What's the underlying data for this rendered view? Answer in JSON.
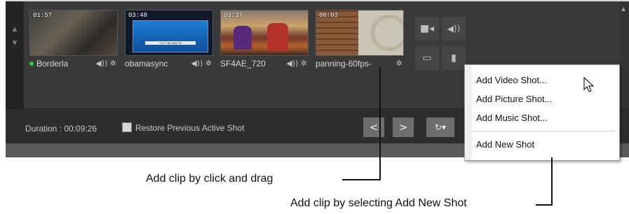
{
  "clips": [
    {
      "time": "01:57",
      "name": "Borderla",
      "active": true
    },
    {
      "time": "03:48",
      "name": "obamasync",
      "active": false,
      "caption": "TCG +06 2040 30"
    },
    {
      "time": "03:37",
      "name": "SF4AE_720",
      "active": false
    },
    {
      "time": "00:03",
      "name": "panning-60fps-",
      "active": false
    }
  ],
  "clip_icons": {
    "audio": "speaker-icon",
    "settings": "gear-icon"
  },
  "tools": [
    {
      "name": "video-camera-icon",
      "glyph": "■◂"
    },
    {
      "name": "speaker-icon",
      "glyph": "◀))"
    },
    {
      "name": "monitor-icon",
      "glyph": "▭"
    },
    {
      "name": "document-icon",
      "glyph": "▮"
    }
  ],
  "bottombar": {
    "duration": "Duration : 00:09:26",
    "restore_label": "Restore Previous Active Shot",
    "prev": "<",
    "next": ">",
    "refresh": "↻▾"
  },
  "menu": {
    "items": [
      "Add Video Shot...",
      "Add Picture Shot...",
      "Add Music Shot...",
      "Add New Shot"
    ]
  },
  "callouts": {
    "drag": "Add clip by click and drag",
    "menu": "Add clip by selecting Add New Shot"
  },
  "colors": {
    "accent_active": "#2ecc40",
    "panel": "#2e2e2e",
    "menu_bg": "#ffffff"
  }
}
